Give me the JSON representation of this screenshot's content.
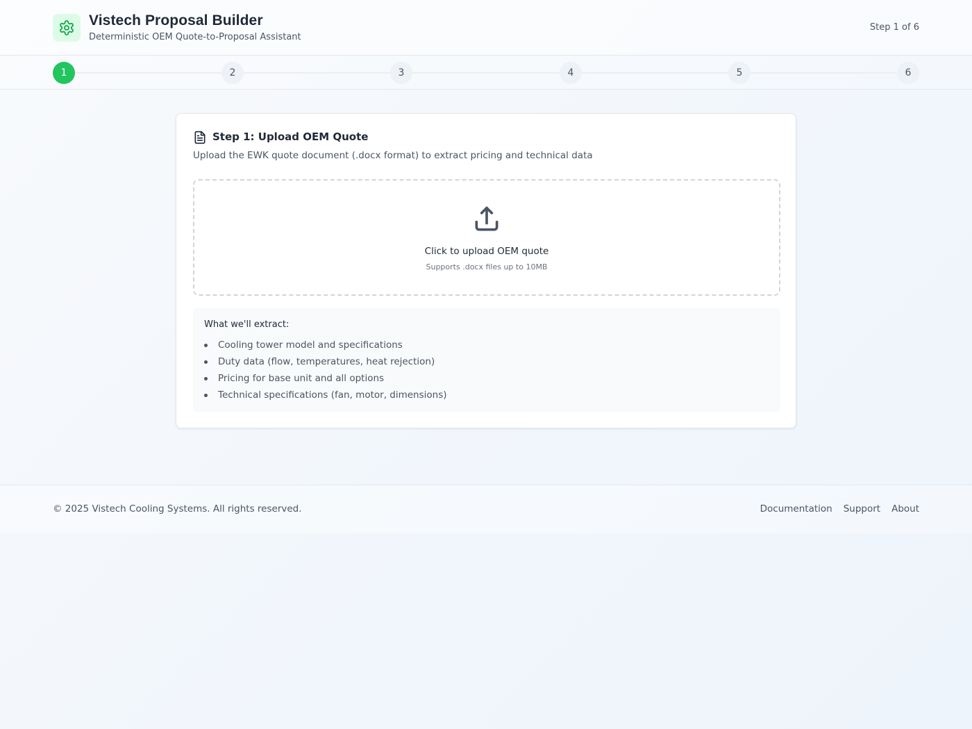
{
  "header": {
    "title": "Vistech Proposal Builder",
    "subtitle": "Deterministic OEM Quote-to-Proposal Assistant",
    "logo_icon": "gear-icon",
    "step_indicator": "Step 1 of 6"
  },
  "stepper": {
    "steps": [
      "1",
      "2",
      "3",
      "4",
      "5",
      "6"
    ],
    "active_step": 1,
    "active_color": "#22c55e"
  },
  "card": {
    "title_icon": "document-icon",
    "title": "Step 1: Upload OEM Quote",
    "description": "Upload the EWK quote document (.docx format) to extract pricing and technical data",
    "upload": {
      "icon": "upload-icon",
      "label": "Click to upload OEM quote",
      "hint": "Supports .docx files up to 10MB"
    },
    "extract": {
      "heading": "What we'll extract:",
      "items": [
        "Cooling tower model and specifications",
        "Duty data (flow, temperatures, heat rejection)",
        "Pricing for base unit and all options",
        "Technical specifications (fan, motor, dimensions)"
      ]
    }
  },
  "footer": {
    "copyright": "© 2025 Vistech Cooling Systems. All rights reserved.",
    "links": [
      "Documentation",
      "Support",
      "About"
    ]
  }
}
